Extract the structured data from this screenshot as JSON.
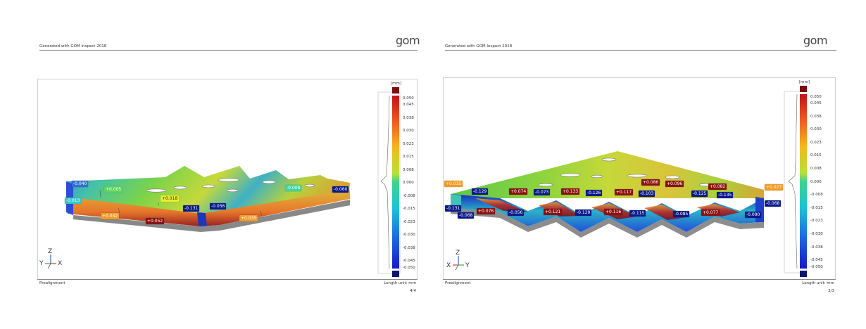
{
  "pages": [
    {
      "header": "Generated with GOM Inspect 2018",
      "logo": "gom",
      "footer_left": "Prealignment",
      "footer_right": "Length unit: mm",
      "page_number": "4/4",
      "scale": {
        "unit": "[mm]",
        "ticks": [
          "0.050",
          "0.045",
          "0.038",
          "0.030",
          "0.023",
          "0.015",
          "0.008",
          "0.000",
          "-0.008",
          "-0.015",
          "-0.023",
          "-0.030",
          "-0.038",
          "-0.045",
          "-0.050"
        ]
      },
      "axes": [
        "Z",
        "Y",
        "X"
      ],
      "labels": [
        {
          "text": "-0.040",
          "color": "#2f6fcf"
        },
        {
          "text": "-0.013",
          "color": "#36c8c8"
        },
        {
          "text": "+0.005",
          "color": "#5fd35f"
        },
        {
          "text": "+0.018",
          "color": "#e8ef30"
        },
        {
          "text": "-0.131",
          "color": "#0b1a8a"
        },
        {
          "text": "-0.056",
          "color": "#0b1a8a"
        },
        {
          "text": "+0.032",
          "color": "#f29b28"
        },
        {
          "text": "+0.052",
          "color": "#8b1212"
        },
        {
          "text": "+0.035",
          "color": "#f29b28"
        },
        {
          "text": "-0.008",
          "color": "#3cd6a6"
        },
        {
          "text": "-0.060",
          "color": "#0b1a8a"
        }
      ]
    },
    {
      "header": "Generated with GOM Inspect 2018",
      "logo": "gom",
      "footer_left": "Prealignment",
      "footer_right": "Length unit: mm",
      "page_number": "3/3",
      "scale": {
        "unit": "[mm]",
        "ticks": [
          "0.050",
          "0.045",
          "0.038",
          "0.030",
          "0.023",
          "0.015",
          "0.008",
          "0.000",
          "-0.008",
          "-0.015",
          "-0.023",
          "-0.030",
          "-0.038",
          "-0.045",
          "-0.050"
        ]
      },
      "axes": [
        "Z",
        "X",
        "Y"
      ],
      "labels": [
        {
          "text": "+0.035",
          "color": "#f29b28"
        },
        {
          "text": "-0.129",
          "color": "#0b1a8a"
        },
        {
          "text": "-0.131",
          "color": "#0b1a8a"
        },
        {
          "text": "-0.068",
          "color": "#0b1a8a"
        },
        {
          "text": "+0.074",
          "color": "#8b1212"
        },
        {
          "text": "+0.076",
          "color": "#8b1212"
        },
        {
          "text": "-0.073",
          "color": "#0b1a8a"
        },
        {
          "text": "-0.056",
          "color": "#0b1a8a"
        },
        {
          "text": "+0.133",
          "color": "#8b1212"
        },
        {
          "text": "+0.121",
          "color": "#8b1212"
        },
        {
          "text": "-0.126",
          "color": "#0b1a8a"
        },
        {
          "text": "-0.129",
          "color": "#0b1a8a"
        },
        {
          "text": "+0.117",
          "color": "#8b1212"
        },
        {
          "text": "+0.116",
          "color": "#8b1212"
        },
        {
          "text": "+0.086",
          "color": "#8b1212"
        },
        {
          "text": "-0.103",
          "color": "#0b1a8a"
        },
        {
          "text": "-0.115",
          "color": "#0b1a8a"
        },
        {
          "text": "+0.096",
          "color": "#8b1212"
        },
        {
          "text": "-0.125",
          "color": "#0b1a8a"
        },
        {
          "text": "-0.085",
          "color": "#0b1a8a"
        },
        {
          "text": "+0.082",
          "color": "#8b1212"
        },
        {
          "text": "-0.135",
          "color": "#0b1a8a"
        },
        {
          "text": "+0.077",
          "color": "#8b1212"
        },
        {
          "text": "+0.027",
          "color": "#f29b28"
        },
        {
          "text": "-0.068",
          "color": "#0b1a8a"
        },
        {
          "text": "-0.090",
          "color": "#0b1a8a"
        }
      ]
    }
  ]
}
